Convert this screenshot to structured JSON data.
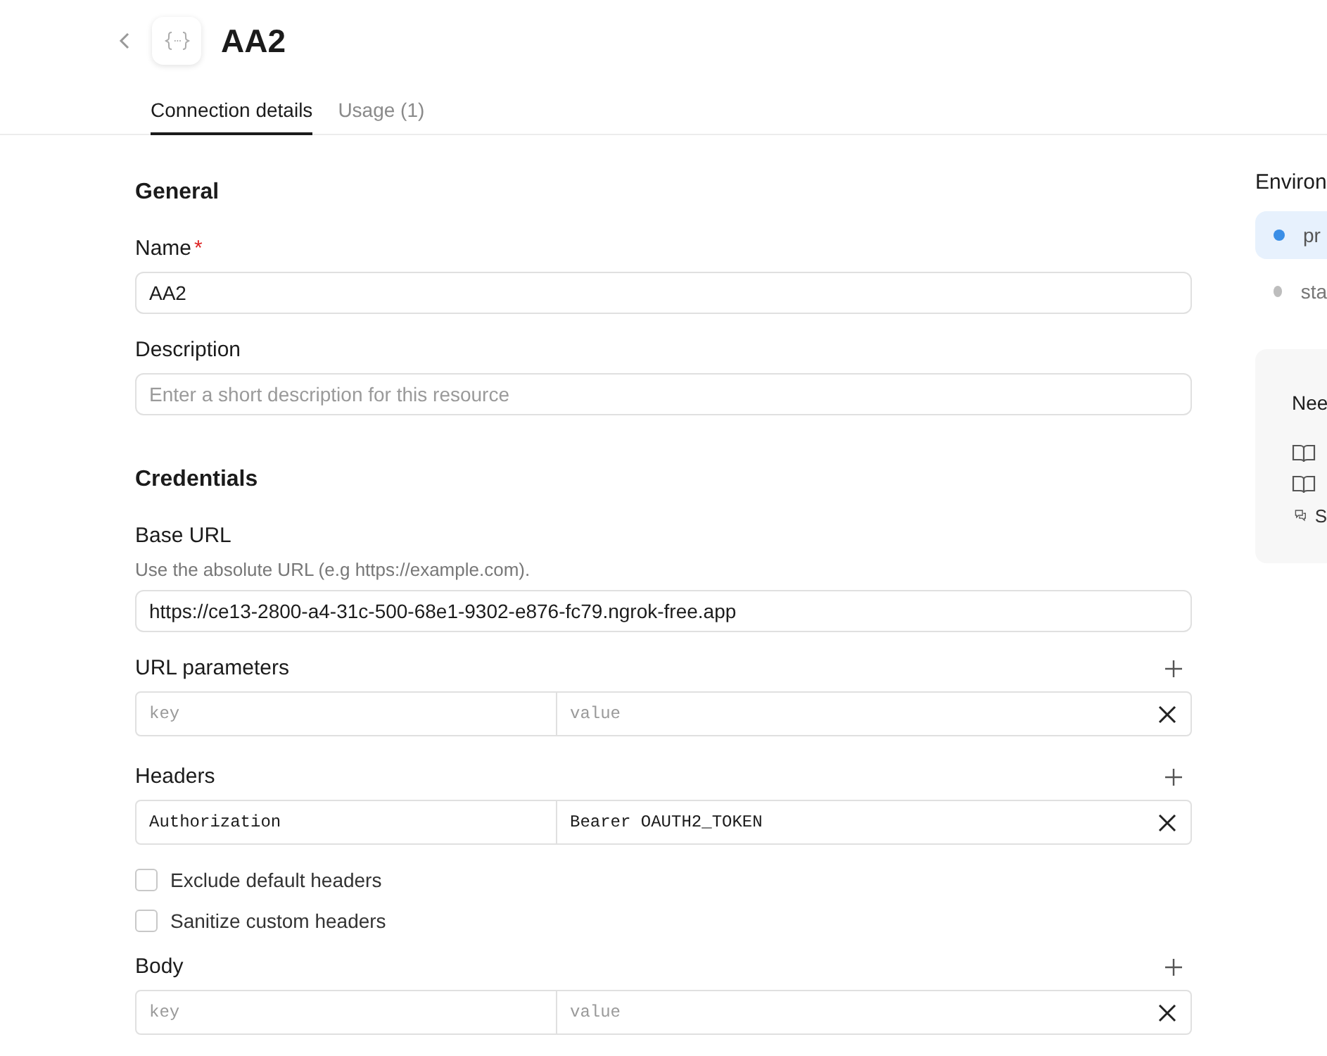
{
  "header": {
    "title": "AA2"
  },
  "tabs": [
    {
      "label": "Connection details",
      "selected": true
    },
    {
      "label": "Usage (1)",
      "selected": false
    }
  ],
  "general": {
    "heading": "General",
    "name": {
      "label": "Name",
      "required_mark": "*",
      "value": "AA2"
    },
    "description": {
      "label": "Description",
      "placeholder": "Enter a short description for this resource"
    }
  },
  "credentials": {
    "heading": "Credentials",
    "base_url": {
      "label": "Base URL",
      "hint": "Use the absolute URL (e.g https://example.com).",
      "value": "https://ce13-2800-a4-31c-500-68e1-9302-e876-fc79.ngrok-free.app"
    },
    "url_parameters": {
      "label": "URL parameters",
      "rows": [
        {
          "key_placeholder": "key",
          "value_placeholder": "value"
        }
      ]
    },
    "headers": {
      "label": "Headers",
      "rows": [
        {
          "key": "Authorization",
          "value": "Bearer OAUTH2_TOKEN"
        }
      ]
    },
    "options": [
      {
        "label": "Exclude default headers",
        "checked": false
      },
      {
        "label": "Sanitize custom headers",
        "checked": false
      }
    ],
    "body": {
      "label": "Body",
      "rows": [
        {
          "key_placeholder": "key",
          "value_placeholder": "value"
        }
      ]
    }
  },
  "environments": {
    "heading": "Environ",
    "items": [
      {
        "label": "pr",
        "selected": true
      },
      {
        "label": "sta",
        "selected": false
      }
    ]
  },
  "help": {
    "heading": "Nee",
    "links": [
      {
        "kind": "book"
      },
      {
        "kind": "book"
      },
      {
        "kind": "chat",
        "label": "S"
      }
    ]
  }
}
